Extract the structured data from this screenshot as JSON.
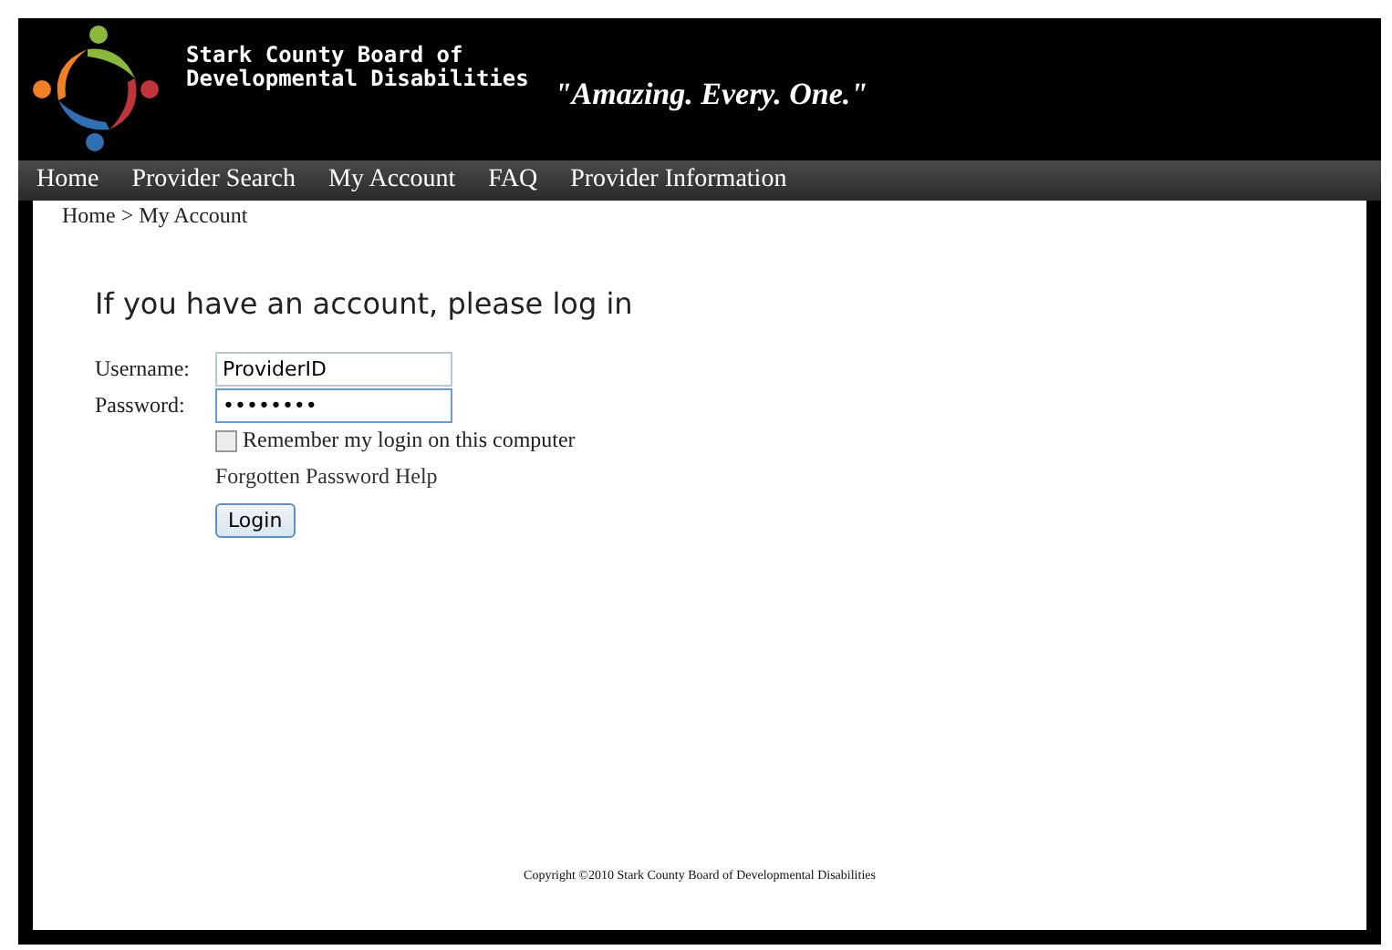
{
  "header": {
    "org_name_line1": "Stark County Board of",
    "org_name_line2": "Developmental Disabilities",
    "tagline": "\"Amazing. Every. One.\""
  },
  "nav": [
    {
      "label": "Home"
    },
    {
      "label": "Provider Search"
    },
    {
      "label": "My Account"
    },
    {
      "label": "FAQ"
    },
    {
      "label": "Provider Information"
    }
  ],
  "breadcrumb": "Home > My Account",
  "login": {
    "heading": "If you have an account, please log in",
    "fields": [
      {
        "label": "Username:",
        "value": "ProviderID",
        "focused": false
      },
      {
        "label": "Password:",
        "value": "••••••••",
        "focused": true
      }
    ],
    "remember": {
      "label": "Remember my login on this computer",
      "checked": false
    },
    "help_link": "Forgotten Password Help",
    "button": "Login"
  },
  "footer": "Copyright ©2010 Stark County Board of Developmental Disabilities"
}
